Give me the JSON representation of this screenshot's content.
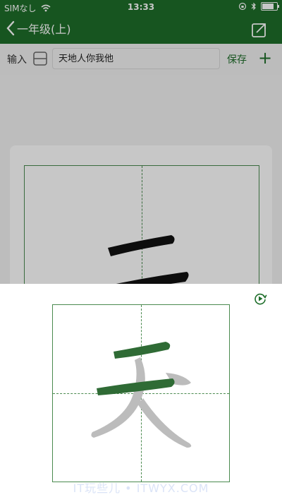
{
  "status_bar": {
    "carrier": "SIMなし",
    "time": "13:33"
  },
  "nav": {
    "back_label": "一年级(上)",
    "accent_color": "#1e6e2a"
  },
  "input_row": {
    "label": "输入",
    "value": "天地人你我他",
    "save_label": "保存",
    "add_label": "+"
  },
  "practice": {
    "current_char": "天",
    "grid_color": "#4a8a4f",
    "stroke_done_color": "#2f6b35",
    "stroke_pending_color": "#bcbcbc"
  },
  "watermark": "IT玩些儿 • ITWYX.COM"
}
